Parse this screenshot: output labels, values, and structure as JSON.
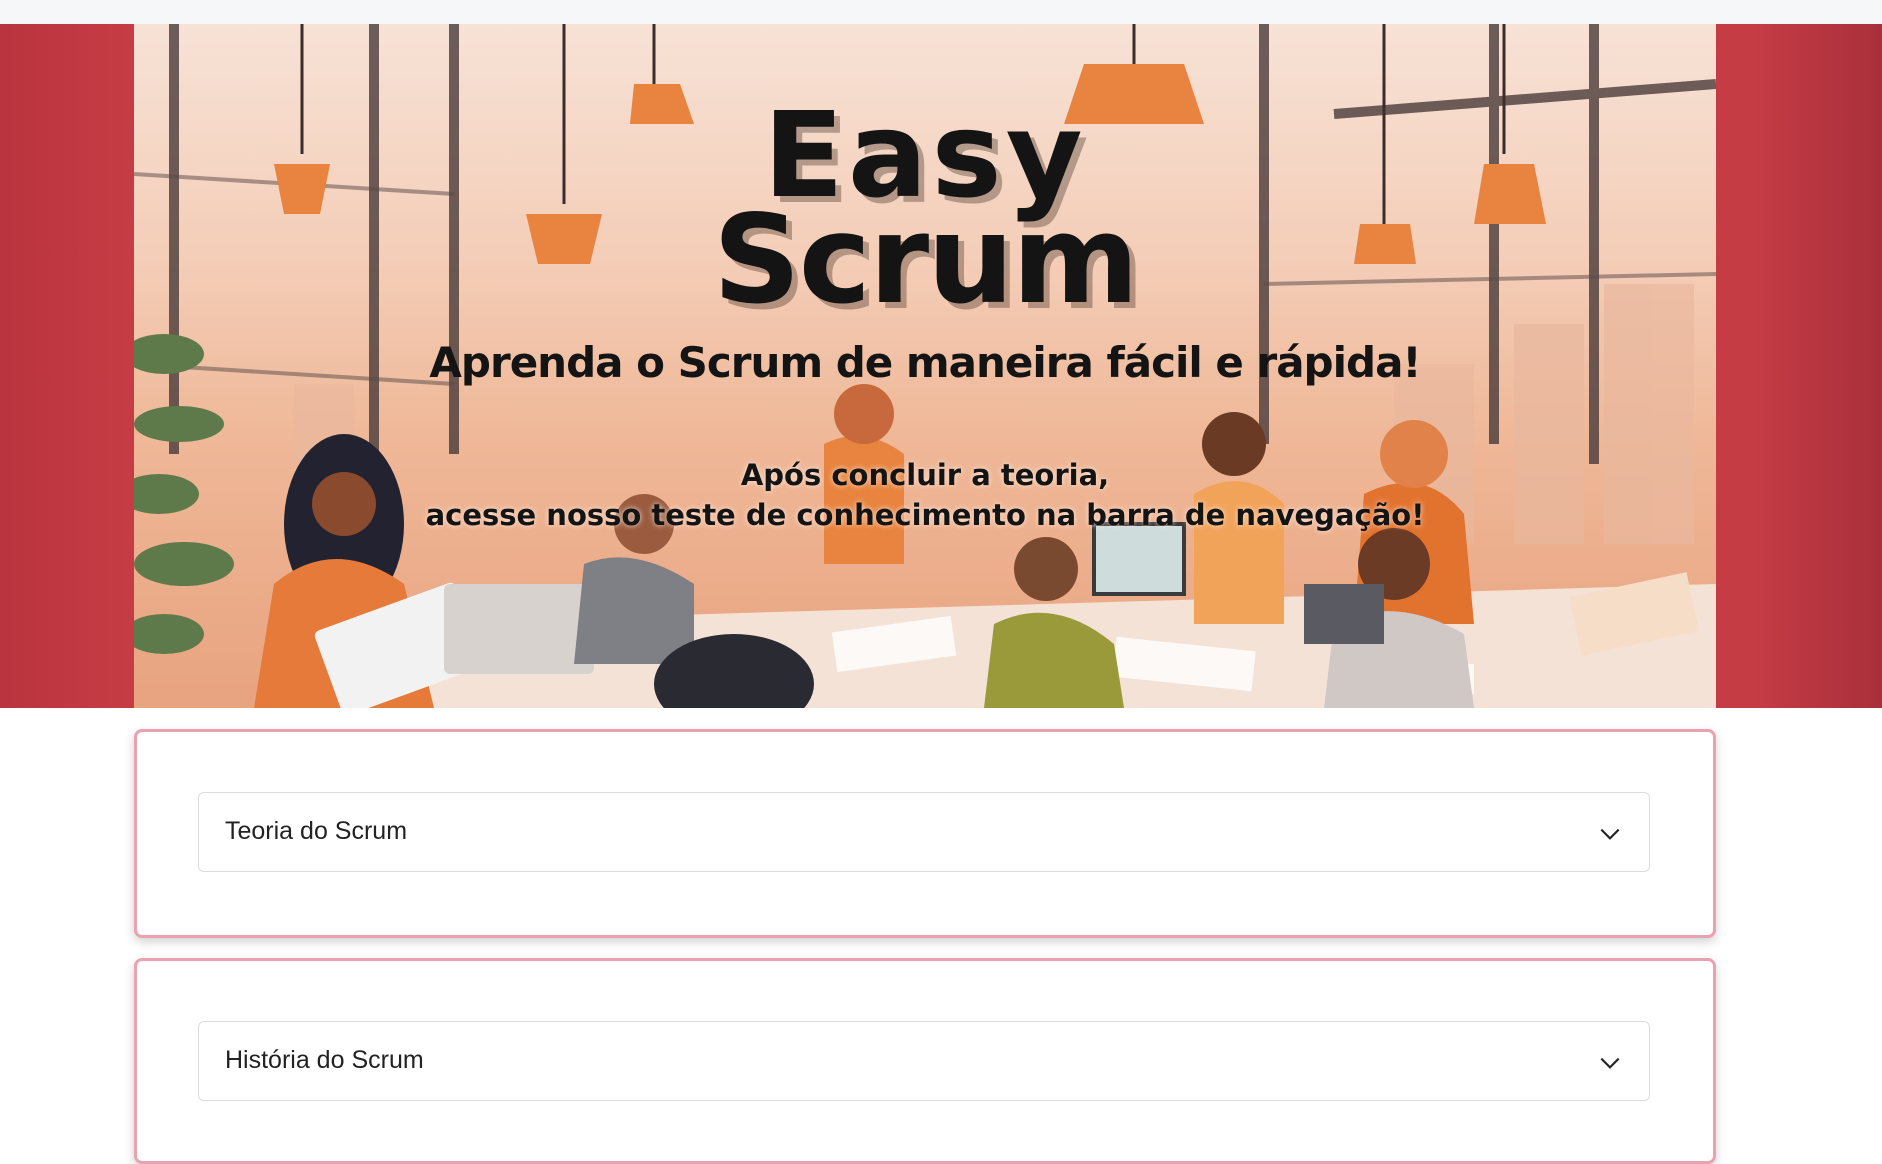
{
  "hero": {
    "title_line1": "Easy",
    "title_line2": "Scrum",
    "subtitle": "Aprenda o Scrum de maneira fácil e rápida!",
    "note_line1": "Após concluir a teoria,",
    "note_line2": "acesse nosso teste de conhecimento na barra de navegação!",
    "image": "illustrated-team-office-scene"
  },
  "colors": {
    "brand_red": "#c63c45",
    "card_border": "#e9a3b0",
    "text_dark": "#222222"
  },
  "accordion": {
    "items": [
      {
        "label": "Teoria do Scrum",
        "icon": "chevron-down-icon",
        "expanded": false
      },
      {
        "label": "História do Scrum",
        "icon": "chevron-down-icon",
        "expanded": false
      }
    ]
  }
}
